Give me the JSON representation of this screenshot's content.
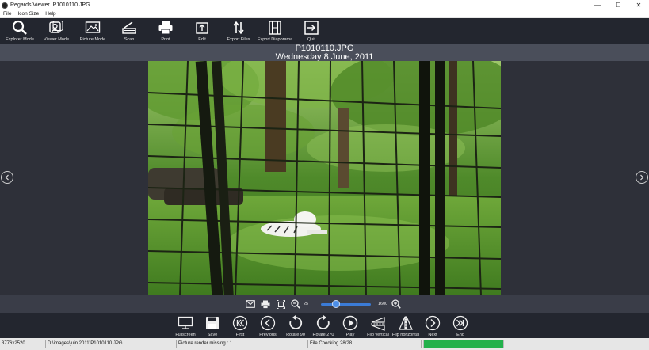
{
  "window": {
    "title": "Regards Viewer :P1010110.JPG",
    "controls": [
      "—",
      "☐",
      "✕"
    ]
  },
  "menu": [
    "File",
    "Icon Size",
    "Help"
  ],
  "toolbar": [
    {
      "label": "Explorer Mode",
      "icon": "search-icon"
    },
    {
      "label": "Viewer Mode",
      "icon": "viewer-icon"
    },
    {
      "label": "Picture Mode",
      "icon": "picture-icon"
    },
    {
      "label": "Scan",
      "icon": "scan-icon"
    },
    {
      "label": "Print",
      "icon": "print-icon"
    },
    {
      "label": "Edit",
      "icon": "edit-icon"
    },
    {
      "label": "Export Files",
      "icon": "export-files-icon"
    },
    {
      "label": "Export Diaporama",
      "icon": "film-icon"
    },
    {
      "label": "Quit",
      "icon": "quit-icon"
    }
  ],
  "header": {
    "filename": "P1010110.JPG",
    "date": "Wednesday 8 June, 2011"
  },
  "zoom": {
    "min_label": "25",
    "max_label": "1600",
    "value_fraction": 0.3
  },
  "nav": [
    {
      "label": "Fullscreen",
      "icon": "monitor-icon"
    },
    {
      "label": "Save",
      "icon": "save-icon"
    },
    {
      "label": "First",
      "icon": "first-icon"
    },
    {
      "label": "Previous",
      "icon": "previous-icon"
    },
    {
      "label": "Rotate 90",
      "icon": "rotate-left-icon"
    },
    {
      "label": "Rotate 270",
      "icon": "rotate-right-icon"
    },
    {
      "label": "Play",
      "icon": "play-icon"
    },
    {
      "label": "Flip vertical",
      "icon": "flip-vertical-icon"
    },
    {
      "label": "Flip horizontal",
      "icon": "flip-horizontal-icon"
    },
    {
      "label": "Next",
      "icon": "next-icon"
    },
    {
      "label": "End",
      "icon": "end-icon"
    }
  ],
  "status": {
    "dimensions": "3776x2520",
    "path": "D:\\images\\juin 2011\\P1010110.JPG",
    "render": "Picture render missing : 1",
    "checking": "File Checking 28/28",
    "progress_fraction": 1.0
  },
  "colors": {
    "toolbar_bg": "#23262f",
    "header_bg": "#4a4e5a",
    "viewer_bg": "#2e3039",
    "progress": "#22b14c",
    "slider": "#3b7bd6"
  }
}
